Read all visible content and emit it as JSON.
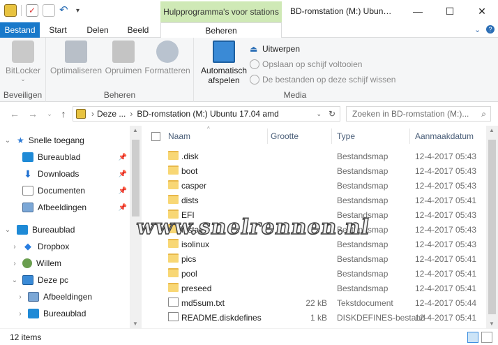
{
  "titlebar": {
    "context_tab": "Hulpprogramma's voor stations",
    "window_title": "BD-romstation (M:) Ubun…",
    "minimize": "—",
    "maximize": "☐",
    "close": "✕"
  },
  "ribbon_tabs": {
    "file": "Bestand",
    "start": "Start",
    "share": "Delen",
    "view": "Beeld",
    "manage": "Beheren",
    "expand": "⌄",
    "help": "?"
  },
  "ribbon": {
    "groups": {
      "beveiligen": "Beveiligen",
      "beheren": "Beheren",
      "media": "Media"
    },
    "bitlocker": "BitLocker",
    "bitlocker_arrow": "⌄",
    "optimaliseren": "Optimaliseren",
    "opruimen": "Opruimen",
    "formatteren": "Formatteren",
    "autoplay_line1": "Automatisch",
    "autoplay_line2": "afspelen",
    "uitwerpen": "Uitwerpen",
    "opslaan": "Opslaan op schijf voltooien",
    "wissen": "De bestanden op deze schijf wissen"
  },
  "address": {
    "breadcrumb_1": "Deze ...",
    "separator": "›",
    "breadcrumb_2": "BD-romstation (M:) Ubuntu 17.04 amd",
    "search_placeholder": "Zoeken in BD-romstation (M:)..."
  },
  "navpane": {
    "items": [
      {
        "label": "Snelle toegang",
        "level": 0,
        "expanded": true
      },
      {
        "label": "Bureaublad",
        "level": 1,
        "pinned": true
      },
      {
        "label": "Downloads",
        "level": 1,
        "pinned": true
      },
      {
        "label": "Documenten",
        "level": 1,
        "pinned": true
      },
      {
        "label": "Afbeeldingen",
        "level": 1,
        "pinned": true
      },
      {
        "label": "Bureaublad",
        "level": 0
      },
      {
        "label": "Dropbox",
        "level": 1
      },
      {
        "label": "Willem",
        "level": 1
      },
      {
        "label": "Deze pc",
        "level": 1,
        "expanded": true
      },
      {
        "label": "Afbeeldingen",
        "level": 2
      },
      {
        "label": "Bureaublad",
        "level": 2
      }
    ]
  },
  "filelist": {
    "columns": {
      "name": "Naam",
      "size": "Grootte",
      "type": "Type",
      "date": "Aanmaakdatum"
    },
    "rows": [
      {
        "name": ".disk",
        "size": "",
        "type": "Bestandsmap",
        "date": "12-4-2017 05:43",
        "kind": "folder"
      },
      {
        "name": "boot",
        "size": "",
        "type": "Bestandsmap",
        "date": "12-4-2017 05:43",
        "kind": "folder"
      },
      {
        "name": "casper",
        "size": "",
        "type": "Bestandsmap",
        "date": "12-4-2017 05:43",
        "kind": "folder"
      },
      {
        "name": "dists",
        "size": "",
        "type": "Bestandsmap",
        "date": "12-4-2017 05:41",
        "kind": "folder"
      },
      {
        "name": "EFI",
        "size": "",
        "type": "Bestandsmap",
        "date": "12-4-2017 05:43",
        "kind": "folder"
      },
      {
        "name": "install",
        "size": "",
        "type": "Bestandsmap",
        "date": "12-4-2017 05:43",
        "kind": "folder"
      },
      {
        "name": "isolinux",
        "size": "",
        "type": "Bestandsmap",
        "date": "12-4-2017 05:43",
        "kind": "folder"
      },
      {
        "name": "pics",
        "size": "",
        "type": "Bestandsmap",
        "date": "12-4-2017 05:41",
        "kind": "folder"
      },
      {
        "name": "pool",
        "size": "",
        "type": "Bestandsmap",
        "date": "12-4-2017 05:41",
        "kind": "folder"
      },
      {
        "name": "preseed",
        "size": "",
        "type": "Bestandsmap",
        "date": "12-4-2017 05:41",
        "kind": "folder"
      },
      {
        "name": "md5sum.txt",
        "size": "22 kB",
        "type": "Tekstdocument",
        "date": "12-4-2017 05:44",
        "kind": "doc"
      },
      {
        "name": "README.diskdefines",
        "size": "1 kB",
        "type": "DISKDEFINES-bestand",
        "date": "12-4-2017 05:41",
        "kind": "doc"
      }
    ]
  },
  "watermark": "www.snelrennen.nl",
  "status": {
    "count": "12 items"
  },
  "colors": {
    "file_tab": "#1979ca",
    "context_green": "#cfe9b6",
    "folder": "#f8d775"
  }
}
